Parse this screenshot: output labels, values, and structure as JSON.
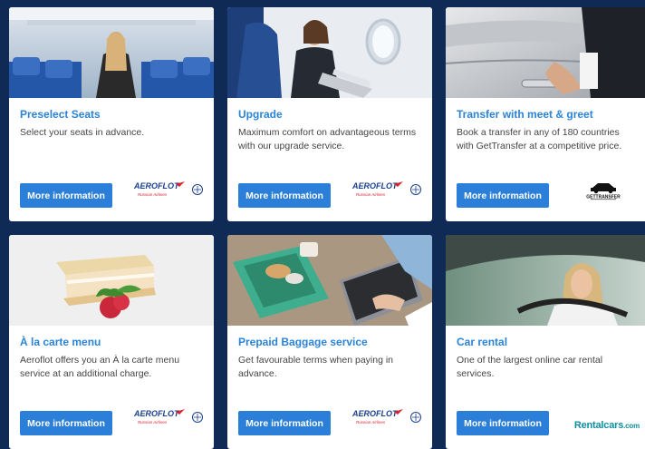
{
  "cards": [
    {
      "title": "Preselect Seats",
      "desc": "Select your seats in advance.",
      "button": "More information",
      "logo_name": "aeroflot-logo",
      "logo_text": "AEROFLOT",
      "logo_sub": "Russian Airlines"
    },
    {
      "title": "Upgrade",
      "desc": "Maximum comfort on advantageous terms with our upgrade service.",
      "button": "More information",
      "logo_name": "aeroflot-logo",
      "logo_text": "AEROFLOT",
      "logo_sub": "Russian Airlines"
    },
    {
      "title": "Transfer with meet & greet",
      "desc": "Book a transfer in any of 180 countries with GetTransfer at a competitive price.",
      "button": "More information",
      "logo_name": "gettransfer-logo",
      "logo_text": "GETTRANSFER"
    },
    {
      "title": "À la carte menu",
      "desc": "Aeroflot offers you an À la carte menu service at an additional charge.",
      "button": "More information",
      "logo_name": "aeroflot-logo",
      "logo_text": "AEROFLOT",
      "logo_sub": "Russian Airlines"
    },
    {
      "title": "Prepaid Baggage service",
      "desc": "Get favourable terms when paying in advance.",
      "button": "More information",
      "logo_name": "aeroflot-logo",
      "logo_text": "AEROFLOT",
      "logo_sub": "Russian Airlines"
    },
    {
      "title": "Car rental",
      "desc": "One of the largest online car rental services.",
      "button": "More information",
      "logo_name": "rentalcars-logo",
      "logo_text": "Rentalcars",
      "logo_suffix": ".com"
    }
  ],
  "colors": {
    "background": "#0f2a55",
    "accent": "#2a83d6",
    "button": "#2b7fd8",
    "aeroflot_blue": "#1a3f8f",
    "aeroflot_red": "#d9232e"
  }
}
